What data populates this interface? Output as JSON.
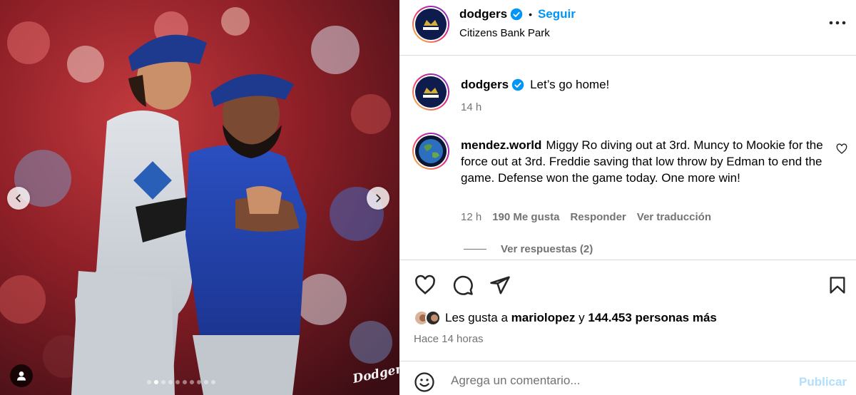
{
  "post": {
    "username": "dodgers",
    "follow_label": "Seguir",
    "separator": "•",
    "location": "Citizens Bank Park",
    "watermark": "Dodgers",
    "carousel": {
      "count": 10,
      "active_index": 1
    }
  },
  "caption": {
    "username": "dodgers",
    "text": "Let’s go home!",
    "time": "14 h"
  },
  "comment": {
    "username": "mendez.world",
    "text": "Miggy Ro diving out at 3rd. Muncy to Mookie for the force out at 3rd. Freddie saving that low throw by Edman to end the game. Defense won the game today. One more win!",
    "time": "12 h",
    "likes": "190 Me gusta",
    "reply_label": "Responder",
    "translate_label": "Ver traducción",
    "view_replies": "Ver respuestas (2)"
  },
  "likes": {
    "prefix": "Les gusta a",
    "user": "mariolopez",
    "joiner": "y",
    "others": "144.453 personas más"
  },
  "timestamp": "Hace 14 horas",
  "add_comment": {
    "placeholder": "Agrega un comentario...",
    "publish_label": "Publicar"
  },
  "colors": {
    "accent": "#0095f6",
    "publish_disabled": "#b2dffc",
    "muted": "#737373",
    "border": "#dbdbdb"
  },
  "icons": [
    "chevron-left-icon",
    "chevron-right-icon",
    "user-tag-icon",
    "verified-icon",
    "more-icon",
    "heart-icon",
    "comment-icon",
    "share-icon",
    "bookmark-icon",
    "emoji-icon"
  ]
}
